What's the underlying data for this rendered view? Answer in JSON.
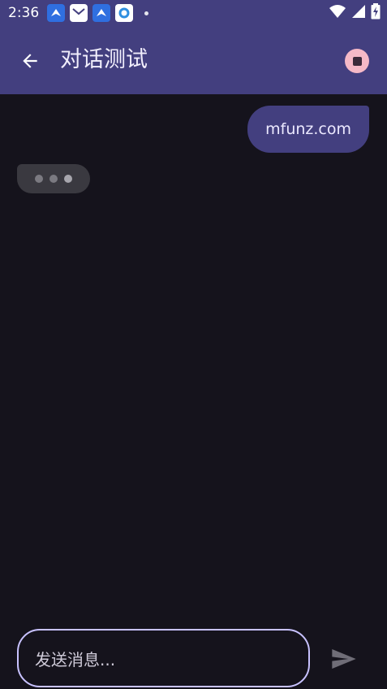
{
  "status_bar": {
    "time": "2:36",
    "icons": [
      "bird-app-icon",
      "mail-icon",
      "bird-app-icon",
      "app-icon",
      "dot-icon"
    ],
    "right_icons": [
      "wifi-icon",
      "signal-icon",
      "battery-charging-icon"
    ]
  },
  "app_bar": {
    "title": "对话测试",
    "back_icon": "arrow-back-icon",
    "stop_icon": "stop-circle-icon",
    "stop_color": "#f5b9c7"
  },
  "chat": {
    "messages": [
      {
        "role": "user",
        "text": "mfunz.com"
      }
    ],
    "typing_indicator": true
  },
  "composer": {
    "placeholder": "发送消息...",
    "send_icon": "send-icon"
  },
  "colors": {
    "primary": "#433f7f",
    "background": "#15131c",
    "input_border": "#c8c2ff"
  }
}
